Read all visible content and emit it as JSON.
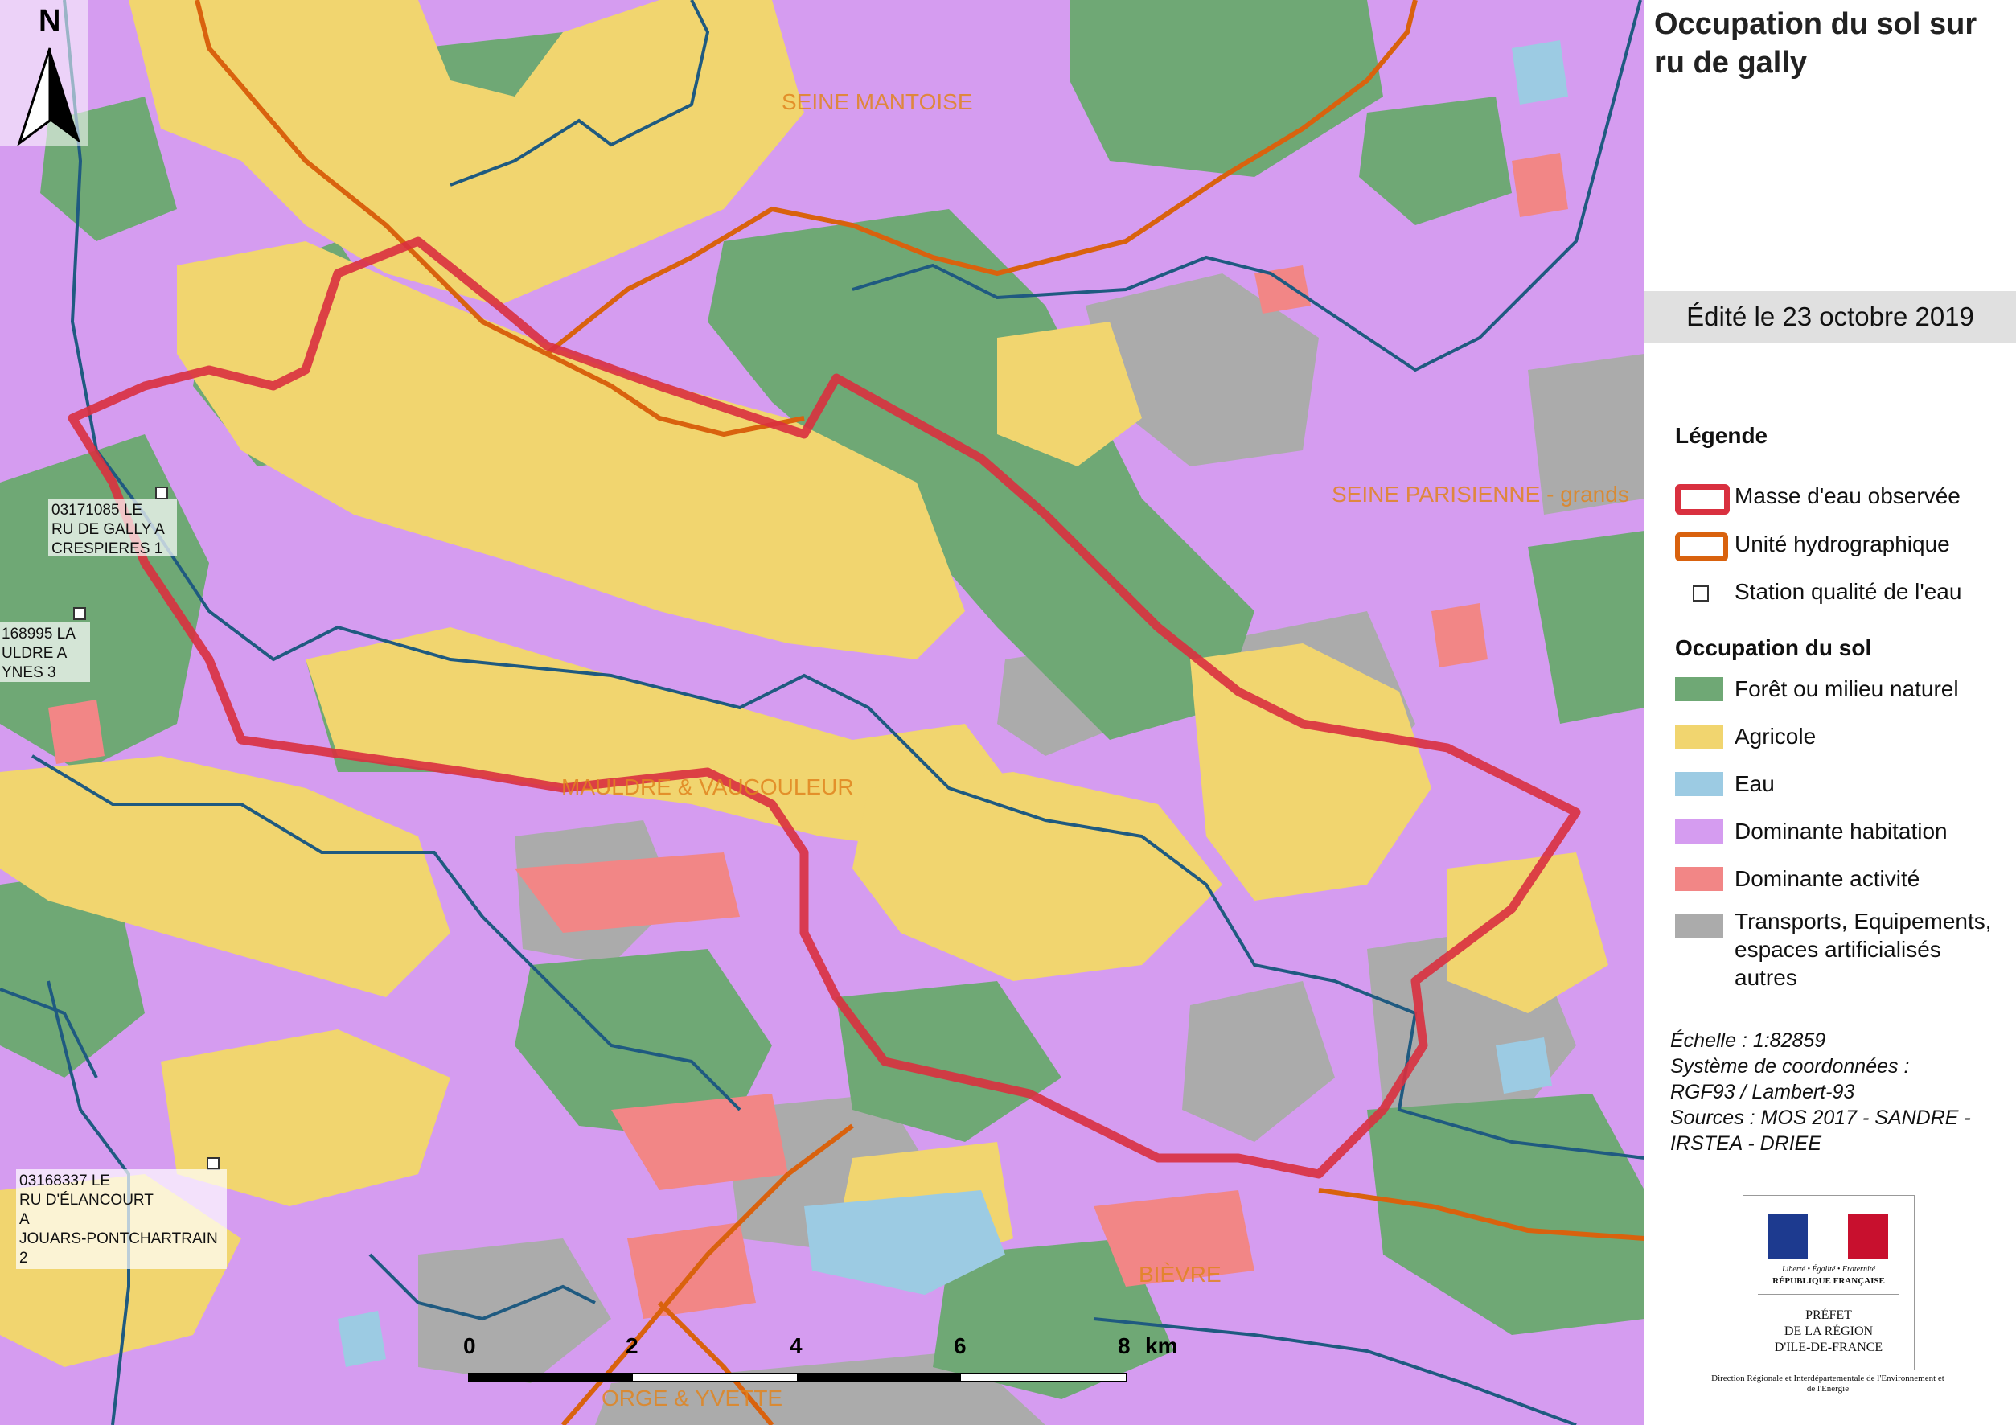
{
  "title": "Occupation du sol sur ru de gally",
  "edited": "Édité le 23 octobre 2019",
  "legend": {
    "heading": "Légende",
    "items": [
      {
        "label": "Masse d'eau observée",
        "kind": "water-body-line",
        "color": "#d9303f"
      },
      {
        "label": "Unité hydrographique",
        "kind": "hydro-unit-line",
        "color": "#d9620e"
      },
      {
        "label": "Station qualité de l'eau",
        "kind": "station-square",
        "color": "#ffffff"
      }
    ],
    "landuse_heading": "Occupation du sol",
    "landuse": [
      {
        "label": "Forêt ou milieu naturel",
        "color": "#6fa875"
      },
      {
        "label": "Agricole",
        "color": "#f1d56f"
      },
      {
        "label": "Eau",
        "color": "#9ccbe3"
      },
      {
        "label": "Dominante habitation",
        "color": "#d59cf0"
      },
      {
        "label": "Dominante activité",
        "color": "#f28686"
      },
      {
        "label": "Transports, Equipements, espaces artificialisés autres",
        "color": "#ababab"
      }
    ]
  },
  "meta": "Échelle :   1:82859\nSystème de coordonnées :\nRGF93 / Lambert-93\nSources : MOS 2017 - SANDRE -\nIRSTEA - DRIEE",
  "logo": {
    "motto": "Liberté • Égalité • Fraternité",
    "republic": "RÉPUBLIQUE FRANÇAISE",
    "prefet_line1": "PRÉFET",
    "prefet_line2": "DE LA RÉGION",
    "prefet_line3": "D'ILE-DE-FRANCE",
    "direction": "Direction Régionale et Interdépartementale de l'Environnement et de l'Energie"
  },
  "north": "N",
  "scale": {
    "ticks": [
      "0",
      "2",
      "4",
      "6",
      "8"
    ],
    "unit": "km"
  },
  "map_labels": [
    {
      "text": "SEINE MANTOISE",
      "role": "hydro-unit"
    },
    {
      "text": "SEINE PARISIENNE - grands",
      "role": "hydro-unit"
    },
    {
      "text": "MAULDRE & VAUCOULEUR",
      "role": "hydro-unit"
    },
    {
      "text": "BIÈVRE",
      "role": "hydro-unit"
    },
    {
      "text": "ORGE & YVETTE",
      "role": "hydro-unit"
    }
  ],
  "stations": [
    {
      "lines": [
        "03171085   LE",
        "RU DE GALLY A",
        "CRESPIERES 1"
      ]
    },
    {
      "lines": [
        "168995   LA",
        "ULDRE A",
        "YNES 3"
      ]
    },
    {
      "lines": [
        "03168337   LE",
        "RU D'ÉLANCOURT",
        "A",
        "JOUARS-PONTCHARTRAIN",
        "2"
      ]
    }
  ],
  "colors": {
    "forest": "#6fa875",
    "agri": "#f1d56f",
    "water": "#9ccbe3",
    "habitat": "#d59cf0",
    "activity": "#f28686",
    "transport": "#ababab",
    "river": "#1f5a80",
    "observed": "#d9303f",
    "hydro": "#d9620e"
  }
}
